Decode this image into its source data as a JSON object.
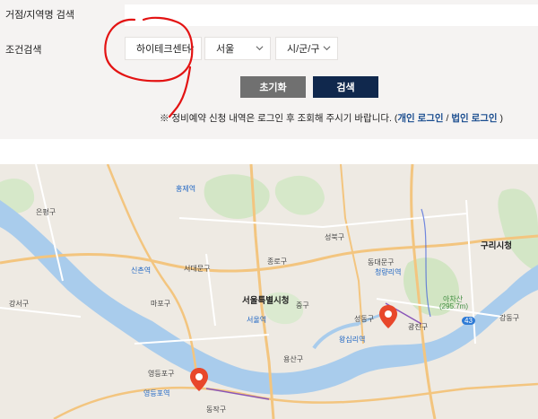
{
  "search": {
    "keyword_label": "거점/지역명 검색",
    "keyword_value": "",
    "condition_label": "조건검색",
    "center_select": "하이테크센터",
    "city_select": "서울",
    "district_select": "시/군/구",
    "reset_button": "초기화",
    "search_button": "검색",
    "notice_prefix": "※ 정비예약 신청 내역은 로그인 후 조회해 주시기 바랍니다. (",
    "personal_login": "개인 로그인",
    "separator": " / ",
    "corporate_login": "법인 로그인",
    "notice_suffix": " )"
  },
  "map": {
    "places": {
      "seoul_city_hall": "서울특별시청",
      "seodaemun": "서대문구",
      "mapo": "마포구",
      "jongno": "종로구",
      "jung": "중구",
      "seongbuk": "성북구",
      "dongdaemun": "동대문구",
      "seongdong": "성동구",
      "gwangjin": "광진구",
      "gangdong": "강동구",
      "yongsan": "용산구",
      "yeongdeungpo": "영등포구",
      "guri": "구리시청",
      "gangseo": "강서구",
      "achasan": "아차산",
      "achasan_height": "(295.7m)",
      "hongje": "홍제역",
      "eunpyeong": "은평구",
      "sinchon": "신촌역",
      "yeongdeungpo_station": "영등포역",
      "seoul_station": "서울역",
      "cheongnyangni": "청량리역",
      "wangsimni": "왕십리역",
      "dongjak": "동작구",
      "route43": "43"
    },
    "pins": [
      "map-pin-seongdong",
      "map-pin-yeongdeungpo"
    ]
  }
}
